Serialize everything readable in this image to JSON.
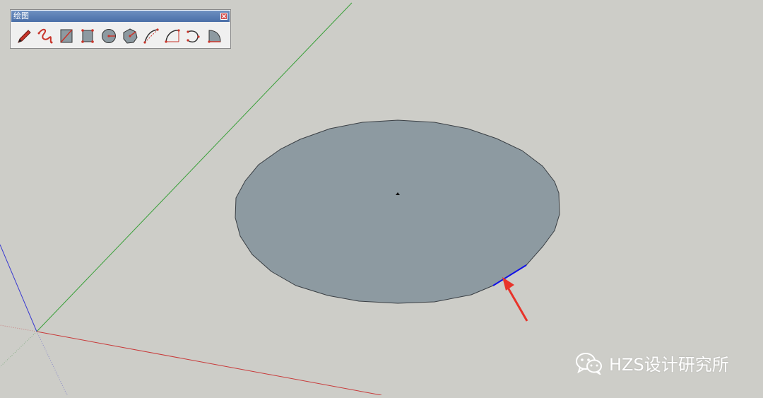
{
  "toolbar": {
    "title": "绘图",
    "tools": [
      {
        "icon": "pencil-icon",
        "tool": "line"
      },
      {
        "icon": "freehand-icon",
        "tool": "freehand"
      },
      {
        "icon": "rectangle-icon",
        "tool": "rectangle"
      },
      {
        "icon": "rotated-rectangle-icon",
        "tool": "rotated-rectangle"
      },
      {
        "icon": "circle-icon",
        "tool": "circle"
      },
      {
        "icon": "polygon-icon",
        "tool": "polygon"
      },
      {
        "icon": "arc-icon",
        "tool": "arc"
      },
      {
        "icon": "two-point-arc-icon",
        "tool": "2-point-arc"
      },
      {
        "icon": "three-point-arc-icon",
        "tool": "3-point-arc"
      },
      {
        "icon": "pie-icon",
        "tool": "pie"
      }
    ]
  },
  "scene": {
    "shape": "circle",
    "selected_edge_color": "#1010e8",
    "face_color": "#8d9aa1",
    "axes": {
      "x_color": "#c83a3a",
      "y_color": "#3aa03a",
      "z_color": "#3a3ad0"
    },
    "annotation_arrow_color": "#e8332a"
  },
  "watermark": {
    "icon": "wechat-icon",
    "text": "HZS设计研究所"
  }
}
